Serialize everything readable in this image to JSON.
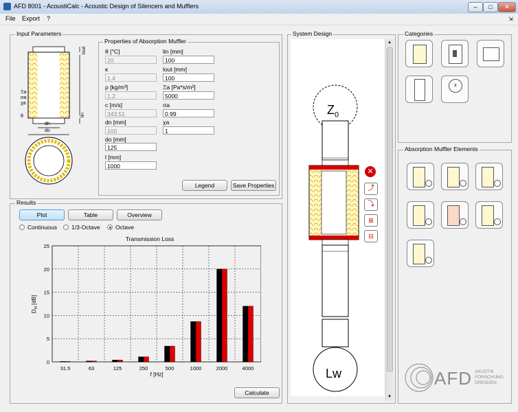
{
  "window": {
    "title": "AFD 8001 - AcoustiCalc - Acoustic Design of Silencers and Mufflers",
    "min": "–",
    "max": "□",
    "close": "✕"
  },
  "menu": {
    "file": "File",
    "export": "Export",
    "help": "?"
  },
  "input_parameters": {
    "title": "Input Parameters",
    "diagram_labels": {
      "lout": "lout",
      "lin": "lin",
      "xi_a": "Ξa",
      "sigma_a": "σa",
      "chi_a": "χa",
      "theta": "θ",
      "dn": "dn",
      "do": "do"
    },
    "properties_title": "Properties of Absorption Muffler",
    "fields": {
      "theta": {
        "label": "θ [°C]",
        "value": "20"
      },
      "kappa": {
        "label": "κ",
        "value": "1.4"
      },
      "rho": {
        "label": "ρ [kg/m³]",
        "value": "1.2"
      },
      "c": {
        "label": "c [m/s]",
        "value": "343.51"
      },
      "dn": {
        "label": "dn [mm]",
        "value": "100"
      },
      "do": {
        "label": "do [mm]",
        "value": "125"
      },
      "l": {
        "label": "l [mm]",
        "value": "1000"
      },
      "lin": {
        "label": "lin [mm]",
        "value": "100"
      },
      "lout": {
        "label": "lout [mm]",
        "value": "100"
      },
      "xi_a": {
        "label": "Ξa [Pa*s/m²]",
        "value": "5000"
      },
      "sigma_a": {
        "label": "σa",
        "value": "0.99"
      },
      "chi_a": {
        "label": "χa",
        "value": "1"
      }
    },
    "legend_button": "Legend",
    "save_button": "Save Properties"
  },
  "results": {
    "title": "Results",
    "tabs": {
      "plot": "Plot",
      "table": "Table",
      "overview": "Overview"
    },
    "radios": {
      "continuous": "Continuous",
      "third_octave": "1/3-Octave",
      "octave": "Octave"
    },
    "selected_radio": "octave",
    "calculate_button": "Calculate"
  },
  "chart_data": {
    "type": "bar",
    "title": "Transmission Loss",
    "xlabel": "f [Hz]",
    "ylabel": "D",
    "ylabel_sub": "H",
    "ylabel_unit": " [dB]",
    "categories": [
      "31.5",
      "63",
      "125",
      "250",
      "500",
      "1000",
      "2000",
      "4000"
    ],
    "series": [
      {
        "color": "#000000",
        "values": [
          0.1,
          0.2,
          0.4,
          1.1,
          3.4,
          8.7,
          20.0,
          12.0
        ]
      },
      {
        "color": "#e00000",
        "values": [
          0.1,
          0.2,
          0.4,
          1.1,
          3.4,
          8.7,
          20.0,
          12.0
        ]
      }
    ],
    "yticks": [
      "0",
      "5",
      "10",
      "15",
      "20",
      "25"
    ],
    "ylim": [
      0,
      25
    ],
    "grid": true
  },
  "system_design": {
    "title": "System Design",
    "z0": "Z",
    "z0_sub": "0",
    "lw": "Lw"
  },
  "categories": {
    "title": "Categories"
  },
  "elements": {
    "title": "Absorption Muffler Elements"
  },
  "logo": {
    "text": "AFD",
    "sub1": "AKUSTIK",
    "sub2": "FORSCHUNG",
    "sub3": "DRESDEN"
  },
  "colors": {
    "accent_red": "#d40000",
    "absorber": "#f3d23a",
    "selected_tab": "#bfe1f8"
  },
  "icons": {
    "delete": "close-circle-icon"
  }
}
